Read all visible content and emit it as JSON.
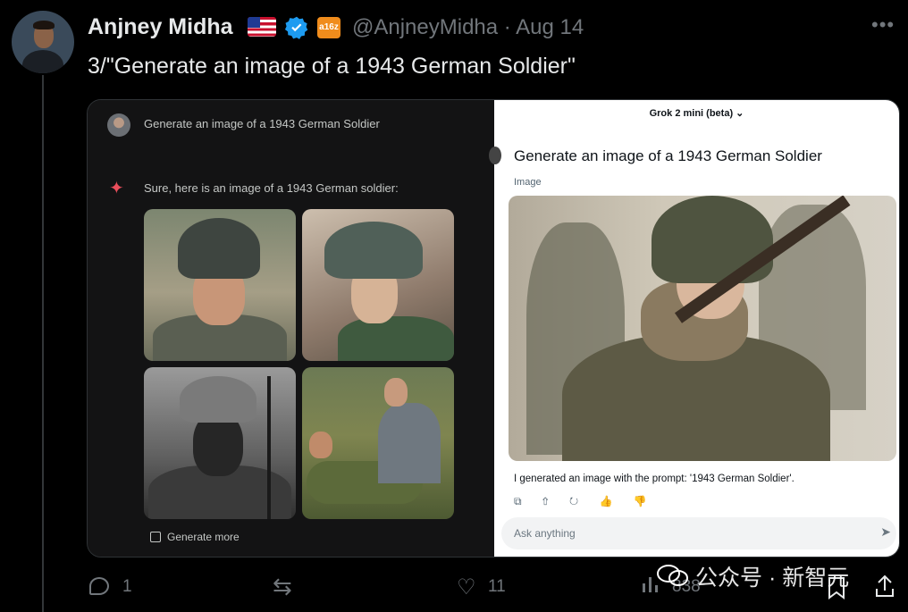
{
  "tweet": {
    "author_name": "Anjney Midha",
    "handle": "@AnjneyMidha",
    "separator": "·",
    "date": "Aug 14",
    "text": "3/\"Generate an image of a 1943 German Soldier\"",
    "more": "•••",
    "badge_text": "a16z",
    "icons": [
      "us-flag-icon",
      "verified-badge-icon",
      "a16z-affiliate-badge"
    ]
  },
  "media": {
    "left_panel": {
      "prompt": "Generate an image of a 1943 German Soldier",
      "response": "Sure, here is an image of a 1943 German soldier:",
      "generate_more": "Generate more",
      "sparkle": "✦"
    },
    "right_panel": {
      "model_selector": "Grok 2 mini (beta) ⌄",
      "prompt": "Generate an image of a 1943 German Soldier",
      "label": "Image",
      "caption": "I generated an image with the prompt: '1943 German Soldier'.",
      "actions": "⧉ ⇧ ↻ 👍 👎",
      "input_placeholder": "Ask anything",
      "send": "➤"
    }
  },
  "engagement": {
    "replies": "1",
    "likes": "11",
    "views": "838"
  },
  "watermark": "公众号 · 新智元",
  "colors": {
    "background": "#000000",
    "text_primary": "#e7e9ea",
    "text_secondary": "#71767b",
    "verified": "#1d9bf0",
    "badge": "#f08c1c"
  }
}
